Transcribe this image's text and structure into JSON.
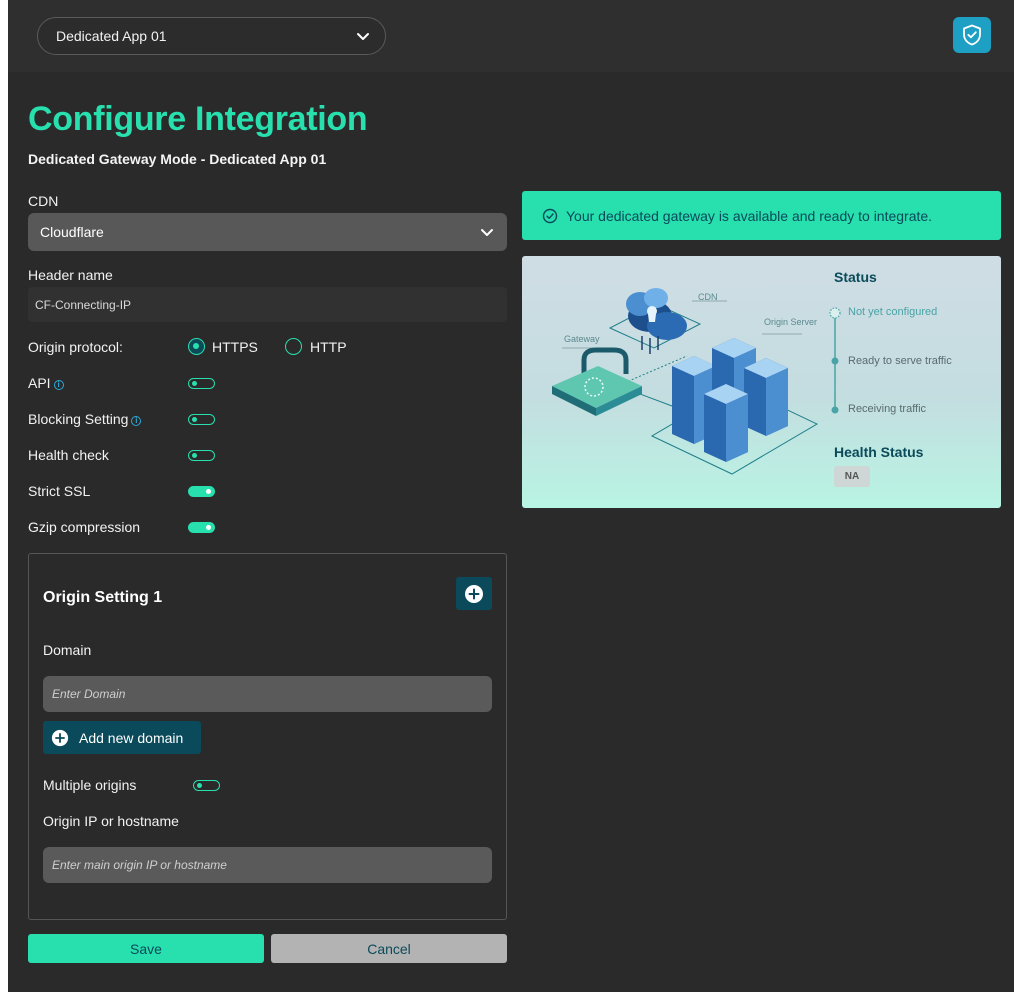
{
  "topbar": {
    "app_selected": "Dedicated App 01",
    "shield_icon": "shield-check-icon"
  },
  "page": {
    "title": "Configure Integration",
    "subtitle": "Dedicated Gateway Mode - Dedicated App 01"
  },
  "form": {
    "cdn_label": "CDN",
    "cdn_value": "Cloudflare",
    "header_name_label": "Header name",
    "header_name_value": "CF-Connecting-IP",
    "origin_protocol_label": "Origin protocol:",
    "protocol_options": [
      "HTTPS",
      "HTTP"
    ],
    "protocol_selected": "HTTPS",
    "toggles": [
      {
        "label": "API",
        "info": true,
        "on": false
      },
      {
        "label": "Blocking Setting",
        "info": true,
        "on": false
      },
      {
        "label": "Health check",
        "info": false,
        "on": false
      },
      {
        "label": "Strict SSL",
        "info": false,
        "on": true
      },
      {
        "label": "Gzip compression",
        "info": false,
        "on": true
      }
    ]
  },
  "origin_setting": {
    "title": "Origin Setting 1",
    "domain_label": "Domain",
    "domain_placeholder": "Enter Domain",
    "add_domain_label": "Add new domain",
    "multiple_origins_label": "Multiple origins",
    "multiple_origins_on": false,
    "origin_ip_label": "Origin IP or hostname",
    "origin_ip_placeholder": "Enter main origin IP or hostname"
  },
  "actions": {
    "save_label": "Save",
    "cancel_label": "Cancel"
  },
  "banner": {
    "text": "Your dedicated gateway is available and ready to integrate."
  },
  "status_card": {
    "diagram_labels": {
      "cdn": "CDN",
      "gateway": "Gateway",
      "origin_server": "Origin Server"
    },
    "status_title": "Status",
    "steps": [
      "Not yet configured",
      "Ready to serve traffic",
      "Receiving traffic"
    ],
    "health_title": "Health Status",
    "health_value": "NA"
  },
  "colors": {
    "accent": "#28dfae",
    "dark_teal": "#0a4a5a",
    "background": "#2a2a2a"
  }
}
